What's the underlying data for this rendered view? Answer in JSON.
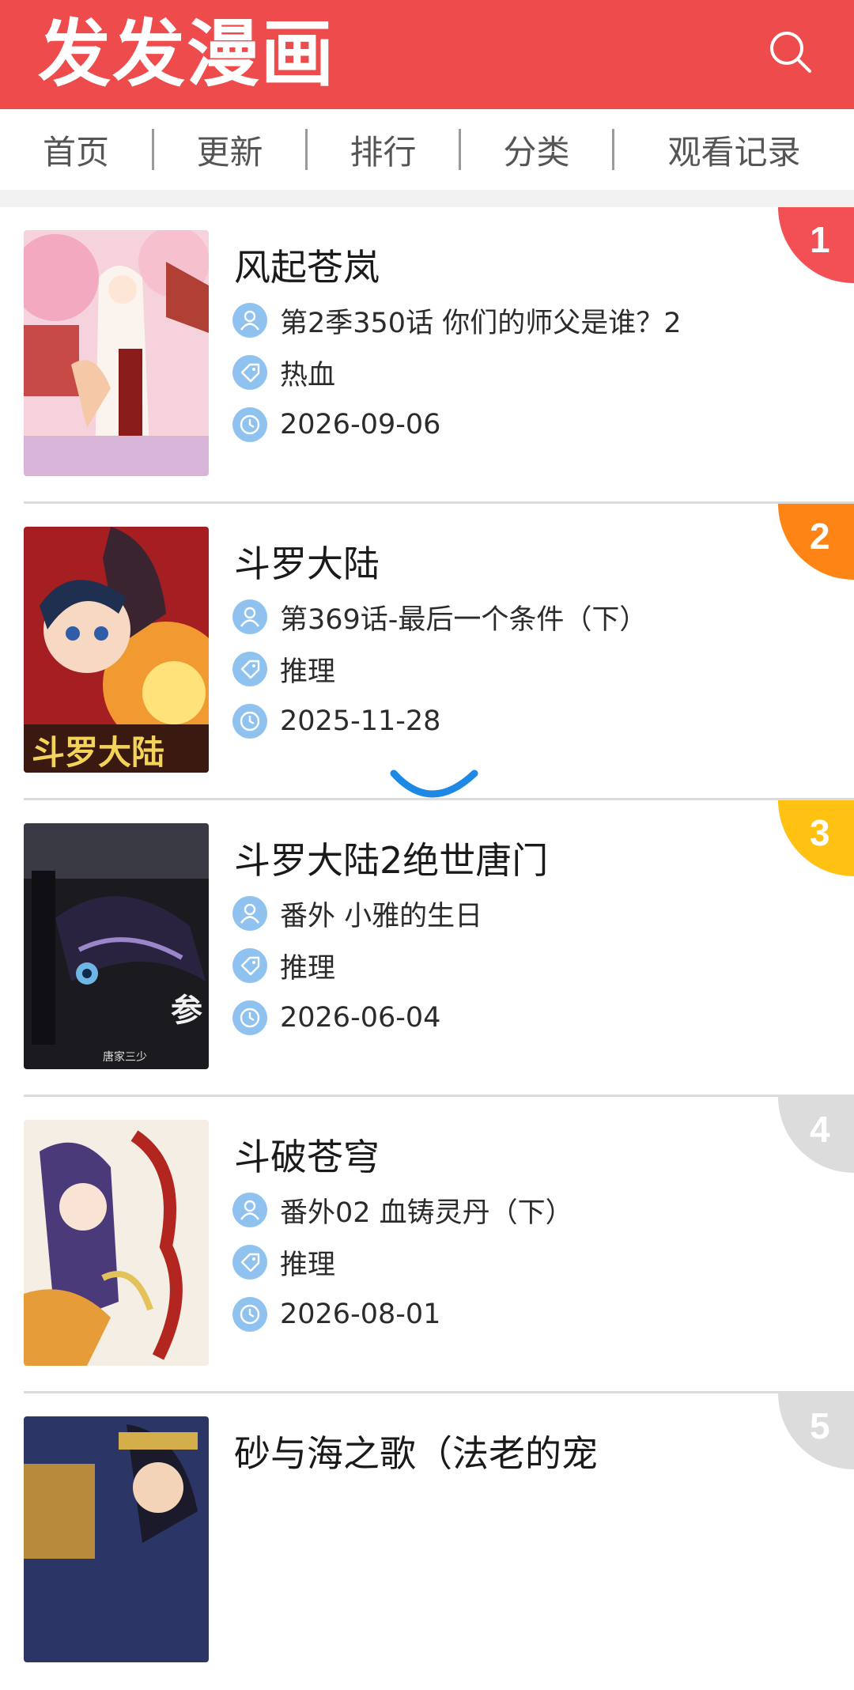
{
  "header": {
    "logo": "发发漫画",
    "search_icon": "search-icon"
  },
  "nav": [
    {
      "label": "首页"
    },
    {
      "label": "更新"
    },
    {
      "label": "排行"
    },
    {
      "label": "分类"
    },
    {
      "label": "观看记录"
    }
  ],
  "colors": {
    "header": "#ee4b4d",
    "rank_1": "#f25055",
    "rank_2": "#ff8416",
    "rank_3": "#ffc213",
    "rank_other": "#dcdcdc",
    "meta_icon": "#8fc2ef",
    "spinner": "#1e88e5"
  },
  "items": [
    {
      "rank": "1",
      "title": "风起苍岚",
      "chapter": "第2季350话 你们的师父是谁？2",
      "genre": "热血",
      "date": "2026-09-06"
    },
    {
      "rank": "2",
      "title": "斗罗大陆",
      "chapter": "第369话-最后一个条件（下）",
      "genre": "推理",
      "date": "2025-11-28"
    },
    {
      "rank": "3",
      "title": "斗罗大陆2绝世唐门",
      "chapter": "番外 小雅的生日",
      "genre": "推理",
      "date": "2026-06-04"
    },
    {
      "rank": "4",
      "title": "斗破苍穹",
      "chapter": "番外02 血铸灵丹（下）",
      "genre": "推理",
      "date": "2026-08-01"
    },
    {
      "rank": "5",
      "title": "砂与海之歌（法老的宠",
      "chapter": "",
      "genre": "",
      "date": ""
    }
  ]
}
